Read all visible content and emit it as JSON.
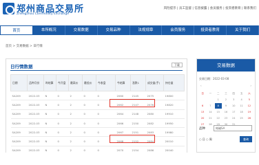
{
  "header": {
    "logo_cn": "郑州商品交易所",
    "logo_en": "Zhengzhou Commodity Exchange",
    "top_links": "风险提示 | 员工监督 | 信息披露 | 会员服务 | 投资者教育 | 联系我们"
  },
  "nav": {
    "items": [
      "首页",
      "本所概况",
      "交易数据",
      "交易品种",
      "法规规章",
      "会员服务",
      "投资者教育",
      "关于我们"
    ]
  },
  "breadcrumb": "首页 > 交易数据 > 日行情",
  "main": {
    "title": "日行情数据",
    "button": "下载",
    "headers": [
      "日期",
      "品种月份",
      "昨结算",
      "今开盘",
      "最高价",
      "最低价",
      "今收盘",
      "今结算",
      "涨跌1",
      "涨跌2",
      "成交量(手)",
      "持仓量"
    ],
    "rows": [
      [
        "SA209",
        "2022-03",
        "N",
        "0",
        "2",
        "0",
        "0",
        "2060",
        "2145",
        "2075",
        "19800"
      ],
      [
        "SA209",
        "2022-03",
        "N",
        "0",
        "2",
        "0",
        "0",
        "2062",
        "2147",
        "2076",
        "19820"
      ],
      [
        "SA209",
        "2022-03",
        "N",
        "0",
        "2",
        "0",
        "0",
        "2064",
        "2148",
        "2080",
        "19910"
      ],
      [
        "SA209",
        "2022-03",
        "N",
        "0",
        "2",
        "0",
        "0",
        "2066",
        "2150",
        "2082",
        "19950"
      ],
      [
        "SA209",
        "2022-03",
        "N",
        "0",
        "2",
        "0",
        "0",
        "2067",
        "2151",
        "2083",
        "19980"
      ],
      [
        "SA209",
        "2022-03",
        "N",
        "0",
        "2",
        "0",
        "0",
        "2068",
        "2152",
        "2084",
        "20010"
      ],
      [
        "SA209",
        "2022-03",
        "N",
        "0",
        "2",
        "0",
        "0",
        "2070",
        "2154",
        "2086",
        "20040"
      ]
    ]
  },
  "side": {
    "title": "交易数据",
    "date": "交易日期：2022-03-08",
    "weekdays": [
      "日",
      "一",
      "二",
      "三",
      "四",
      "五",
      "六"
    ],
    "days": [
      "",
      "",
      "1",
      "2",
      "3",
      "4",
      "5",
      "6",
      "7",
      "8",
      "9",
      "10",
      "11",
      "12",
      "13",
      "14",
      "15",
      "16",
      "17",
      "18",
      "19",
      "20",
      "21",
      "22",
      "23",
      "24",
      "25",
      "26",
      "27",
      "28",
      "29",
      "30",
      "31",
      "",
      ""
    ],
    "select_label": "品种",
    "select_value": "纯碱SA",
    "radio": "○ 日   ○ 周",
    "query_button": "查询"
  }
}
